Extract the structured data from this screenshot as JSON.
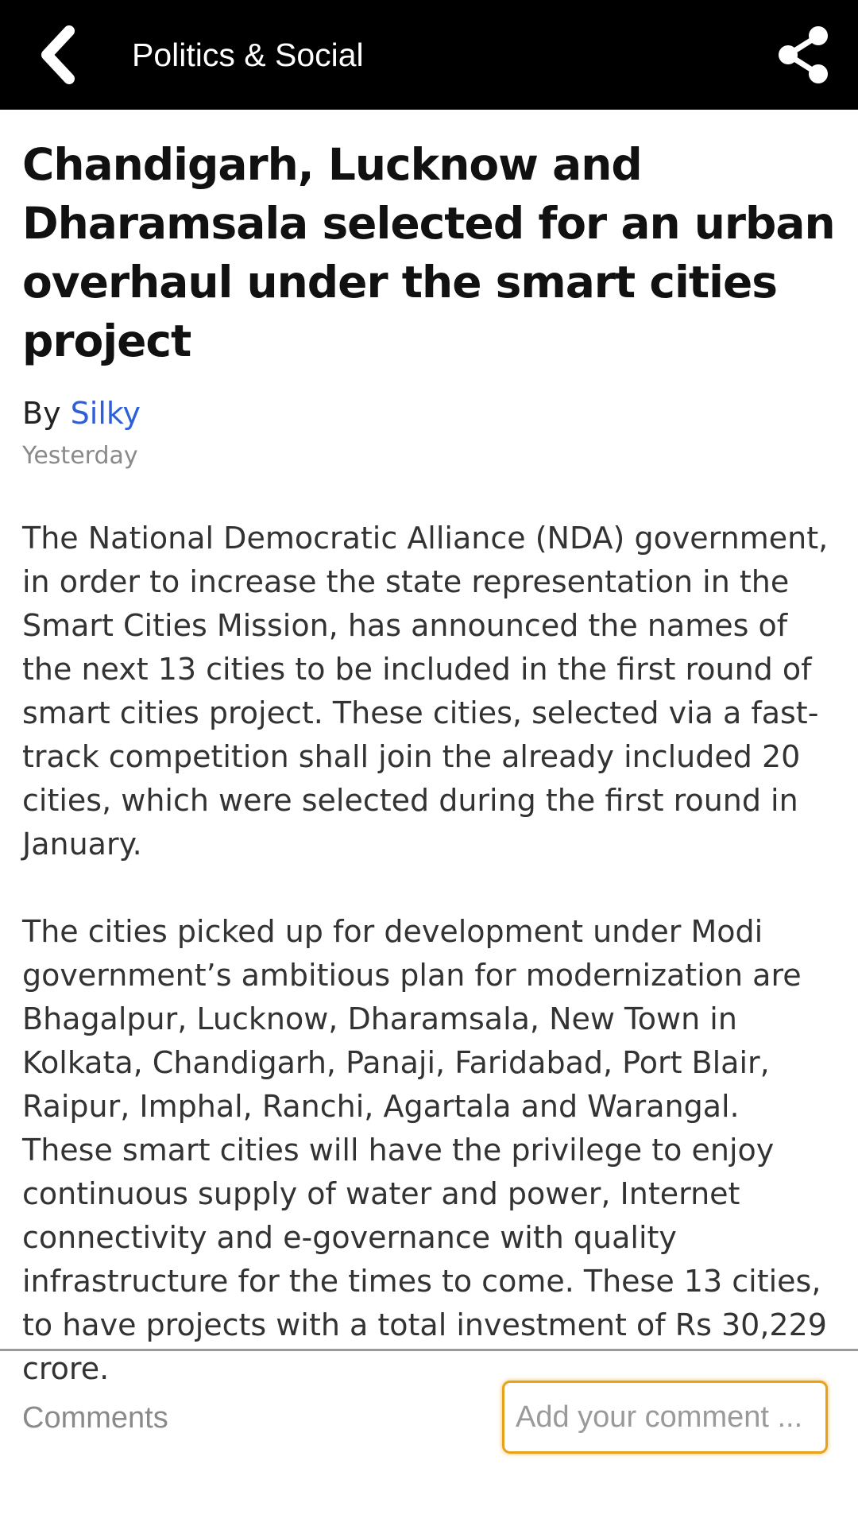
{
  "app_bar": {
    "title": "Politics & Social",
    "back_icon": "chevron-left-icon",
    "share_icon": "share-icon"
  },
  "article": {
    "headline": "Chandigarh, Lucknow and Dharamsala selected for an urban overhaul under the smart cities project",
    "byline_prefix": "By ",
    "author": "Silky",
    "date": "Yesterday",
    "paragraphs": [
      "The National Democratic Alliance (NDA) government, in order to increase the state representation in the Smart Cities Mission, has announced the names of the next 13 cities to be included in the first round of smart cities project. These cities, selected via a fast-track competition shall join the already included 20 cities, which were selected during the first round in January.",
      "The cities picked up for development under Modi government’s ambitious plan for modernization are Bhagalpur, Lucknow, Dharamsala, New Town in Kolkata, Chandigarh, Panaji, Faridabad, Port Blair, Raipur, Imphal, Ranchi, Agartala and Warangal. These smart cities will have the privilege to enjoy continuous supply of water and power, Internet connectivity and e-governance with quality infrastructure for the times to come. These 13 cities, to have projects with a total investment of Rs 30,229 crore."
    ]
  },
  "comments": {
    "label": "Comments",
    "input_placeholder": "Add your comment ...",
    "input_value": ""
  },
  "colors": {
    "app_bar_bg": "#000000",
    "author_link": "#2f5fd8",
    "input_focus_border": "#e8a21a"
  }
}
